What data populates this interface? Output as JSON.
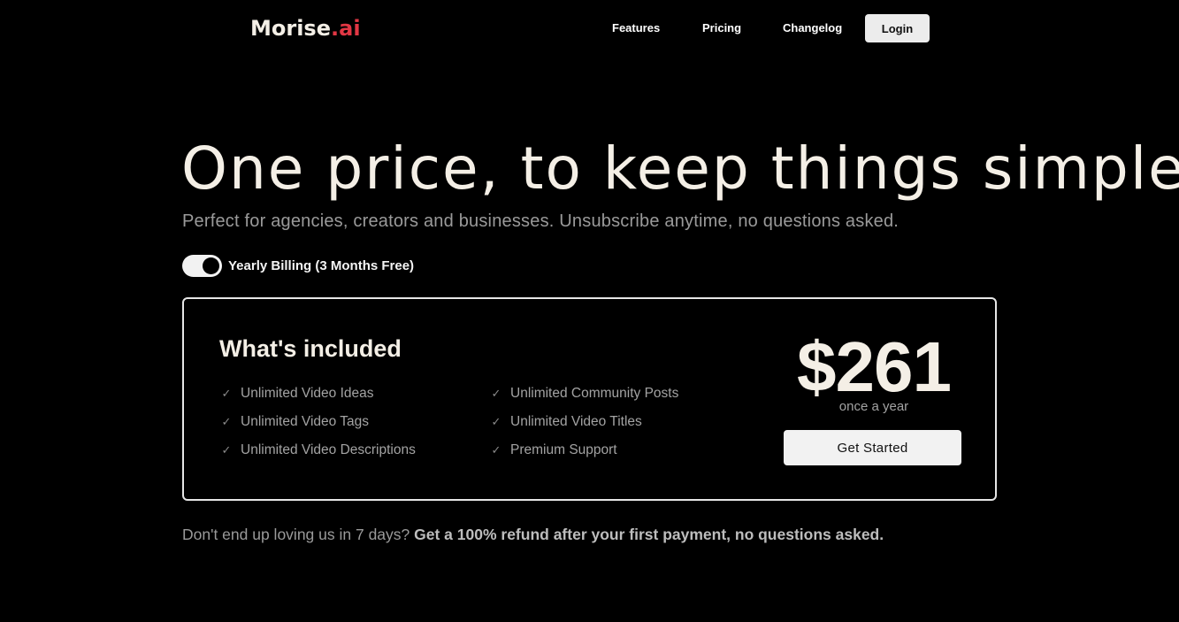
{
  "header": {
    "brand_name": "Morise",
    "brand_dot": ".",
    "brand_tld": "ai",
    "nav": {
      "features": "Features",
      "pricing": "Pricing",
      "changelog": "Changelog"
    },
    "login_label": "Login"
  },
  "hero": {
    "title": "One price, to keep things simple",
    "subtitle": "Perfect for agencies, creators and businesses. Unsubscribe anytime, no questions asked."
  },
  "billing_toggle": {
    "label": "Yearly Billing (3 Months Free)",
    "on": true
  },
  "plan": {
    "included_title": "What's included",
    "features": [
      "Unlimited Video Ideas",
      "Unlimited Video Tags",
      "Unlimited Video Descriptions",
      "Unlimited Community Posts",
      "Unlimited Video Titles",
      "Premium Support"
    ],
    "price": "$261",
    "period": "once a year",
    "cta_label": "Get Started"
  },
  "refund_note": {
    "question": "Don't end up loving us in 7 days?",
    "emphasis": "Get a 100% refund after your first payment, no questions asked."
  },
  "colors": {
    "background": "#000000",
    "brand_accent": "#e23744",
    "heading_text": "#f4efe6",
    "muted_text": "#9a9a9a"
  },
  "icons": {
    "feature_check": "check-icon"
  }
}
